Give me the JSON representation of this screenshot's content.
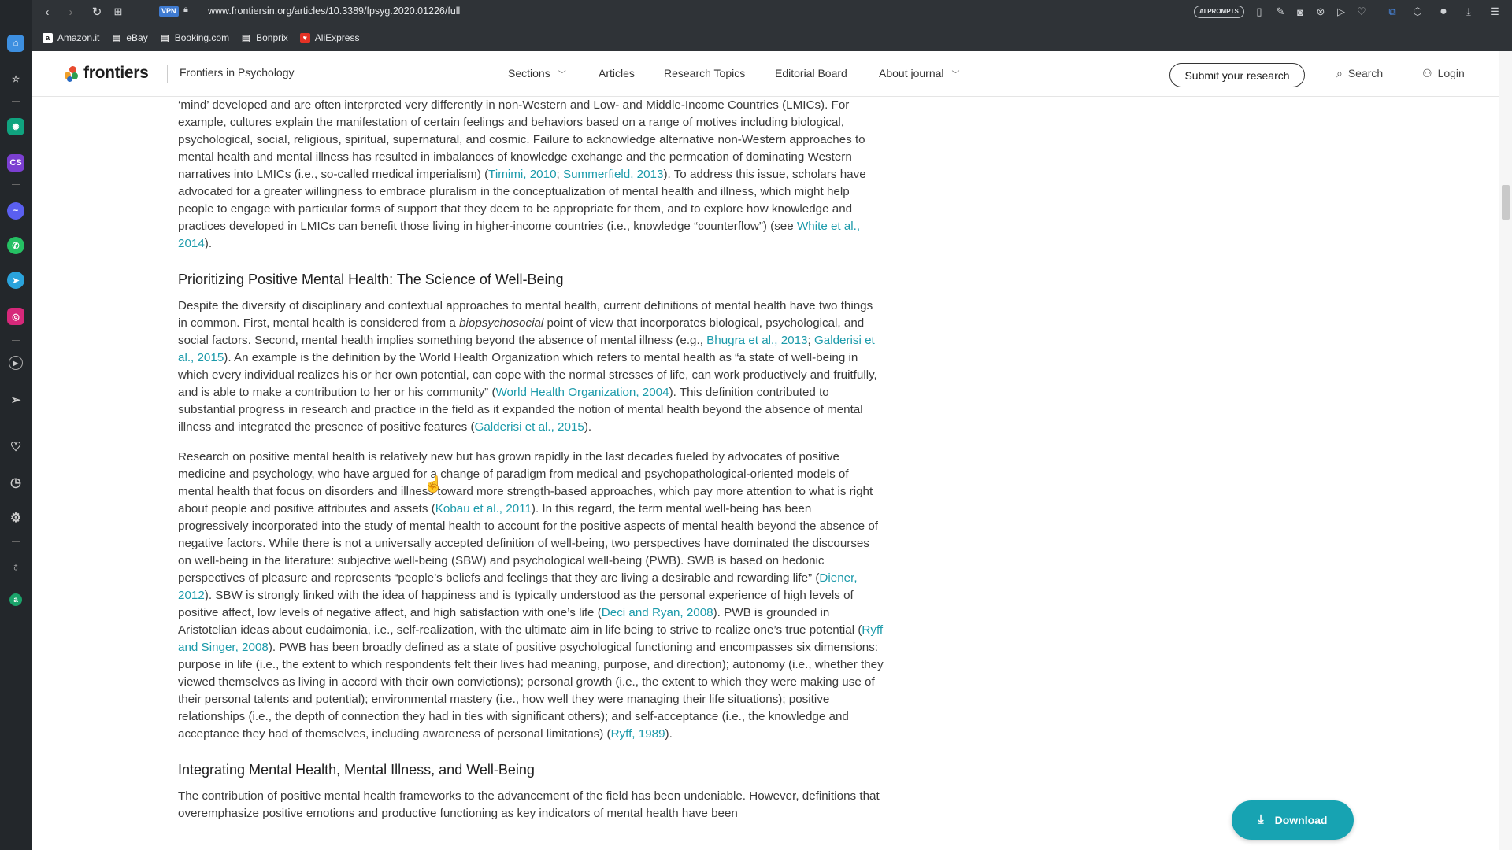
{
  "browser": {
    "url": "www.frontiersin.org/articles/10.3389/fpsyg.2020.01226/full",
    "vpn_label": "VPN",
    "ai_prompts_label": "AI PROMPTS",
    "bookmarks": [
      {
        "label": "Amazon.it",
        "icon": "amazon-icon"
      },
      {
        "label": "eBay",
        "icon": "page-icon"
      },
      {
        "label": "Booking.com",
        "icon": "page-icon"
      },
      {
        "label": "Bonprix",
        "icon": "page-icon"
      },
      {
        "label": "AliExpress",
        "icon": "aliexpress-icon"
      }
    ]
  },
  "header": {
    "logo_text": "frontiers",
    "journal": "Frontiers in Psychology",
    "nav": {
      "sections": "Sections",
      "articles": "Articles",
      "research_topics": "Research Topics",
      "editorial_board": "Editorial Board",
      "about_journal": "About journal"
    },
    "submit_label": "Submit your research",
    "search_label": "Search",
    "login_label": "Login"
  },
  "article": {
    "p0": {
      "t1": "‘mind’ developed and are often interpreted very differently in non-Western and Low- and Middle-Income Countries (LMICs). For example, cultures explain the manifestation of certain feelings and behaviors based on a range of motives including biological, psychological, social, religious, spiritual, supernatural, and cosmic. Failure to acknowledge alternative non-Western approaches to mental health and mental illness has resulted in imbalances of knowledge exchange and the permeation of dominating Western narratives into LMICs (i.e., so-called medical imperialism) (",
      "l1": "Timimi, 2010",
      "t2": "; ",
      "l2": "Summerfield, 2013",
      "t3": "). To address this issue, scholars have advocated for a greater willingness to embrace pluralism in the conceptualization of mental health and illness, which might help people to engage with particular forms of support that they deem to be appropriate for them, and to explore how knowledge and practices developed in LMICs can benefit those living in higher-income countries (i.e., knowledge “counterflow”) (see ",
      "l3": "White et al., 2014",
      "t4": ")."
    },
    "h1": "Prioritizing Positive Mental Health: The Science of Well-Being",
    "p1": {
      "t1": "Despite the diversity of disciplinary and contextual approaches to mental health, current definitions of mental health have two things in common. First, mental health is considered from a ",
      "em1": "biopsychosocial",
      "t2": " point of view that incorporates biological, psychological, and social factors. Second, mental health implies something beyond the absence of mental illness (e.g., ",
      "l1": "Bhugra et al., 2013",
      "t3": "; ",
      "l2": "Galderisi et al., 2015",
      "t4": "). An example is the definition by the World Health Organization which refers to mental health as “a state of well-being in which every individual realizes his or her own potential, can cope with the normal stresses of life, can work productively and fruitfully, and is able to make a contribution to her or his community” (",
      "l3": "World Health Organization, 2004",
      "t5": "). This definition contributed to substantial progress in research and practice in the field as it expanded the notion of mental health beyond the absence of mental illness and integrated the presence of positive features (",
      "l4": "Galderisi et al., 2015",
      "t6": ")."
    },
    "p2": {
      "t1": "Research on positive mental health is relatively new but has grown rapidly in the last decades fueled by advocates of positive medicine and psychology, who have argued for a change of paradigm from medical and psychopathological-oriented models of mental health that focus on disorders and illness toward more strength-based approaches, which pay more attention to what is right about people and positive attributes and assets (",
      "l1": "Kobau et al., 2011",
      "t2": "). In this regard, the term mental well-being has been progressively incorporated into the study of mental health to account for the positive aspects of mental health beyond the absence of negative factors. While there is not a universally accepted definition of well-being, two perspectives have dominated the discourses on well-being in the literature: subjective well-being (SBW) and psychological well-being (PWB). SWB is based on hedonic perspectives of pleasure and represents “people’s beliefs and feelings that they are living a desirable and rewarding life” (",
      "l2": "Diener, 2012",
      "t3": "). SBW is strongly linked with the idea of happiness and is typically understood as the personal experience of high levels of positive affect, low levels of negative affect, and high satisfaction with one’s life (",
      "l3": "Deci and Ryan, 2008",
      "t4": "). PWB is grounded in Aristotelian ideas about eudaimonia, i.e., self-realization, with the ultimate aim in life being to strive to realize one’s true potential (",
      "l4": "Ryff and Singer, 2008",
      "t5": "). PWB has been broadly defined as a state of positive psychological functioning and encompasses six dimensions: purpose in life (i.e., the extent to which respondents felt their lives had meaning, purpose, and direction); autonomy (i.e., whether they viewed themselves as living in accord with their own convictions); personal growth (i.e., the extent to which they were making use of their personal talents and potential); environmental mastery (i.e., how well they were managing their life situations); positive relationships (i.e., the depth of connection they had in ties with significant others); and self-acceptance (i.e., the knowledge and acceptance they had of themselves, including awareness of personal limitations) (",
      "l5": "Ryff, 1989",
      "t6": ")."
    },
    "h2": "Integrating Mental Health, Mental Illness, and Well-Being",
    "p3": {
      "t1": "The contribution of positive mental health frameworks to the advancement of the field has been undeniable. However, definitions that overemphasize positive emotions and productive functioning as key indicators of mental health have been"
    }
  },
  "download_label": "Download",
  "colors": {
    "link": "#1b9aaa",
    "accent": "#17a3b2",
    "chrome": "#2f3337",
    "sidebar": "#23272b"
  }
}
